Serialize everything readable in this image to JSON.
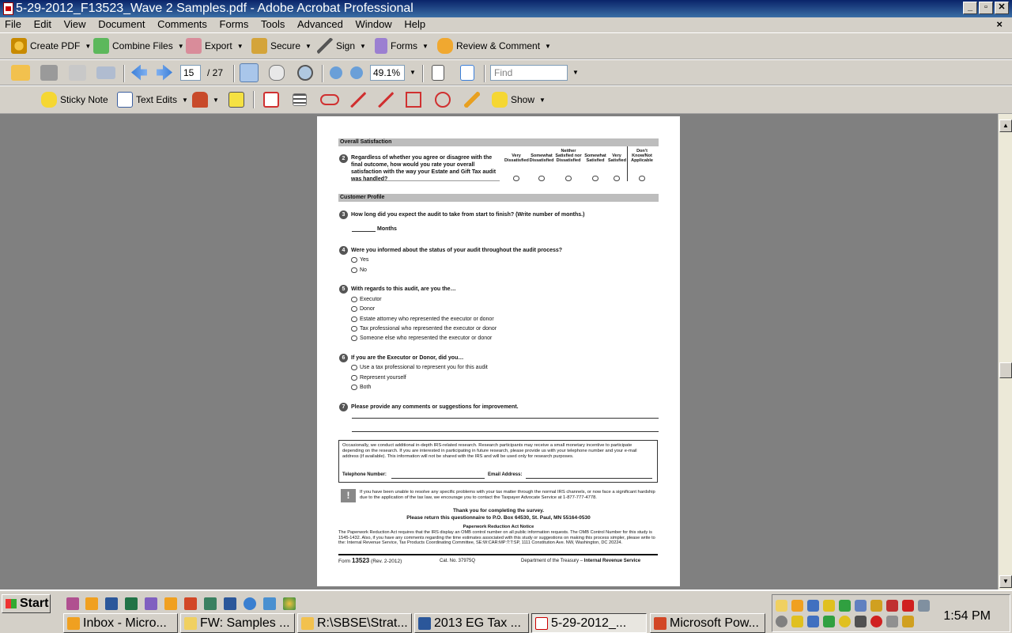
{
  "window": {
    "title": "5-29-2012_F13523_Wave 2 Samples.pdf - Adobe Acrobat Professional",
    "minimize": "_",
    "restore": "▫",
    "close": "✕"
  },
  "menu": [
    "File",
    "Edit",
    "View",
    "Document",
    "Comments",
    "Forms",
    "Tools",
    "Advanced",
    "Window",
    "Help"
  ],
  "menu_close": "×",
  "toolbar1": {
    "create_pdf": "Create PDF",
    "combine_files": "Combine Files",
    "export": "Export",
    "secure": "Secure",
    "sign": "Sign",
    "forms": "Forms",
    "review_comment": "Review & Comment"
  },
  "toolbar2": {
    "page_current": "15",
    "page_total": "/ 27",
    "zoom": "49.1%",
    "find_placeholder": "Find"
  },
  "toolbar3": {
    "sticky_note": "Sticky Note",
    "text_edits": "Text Edits",
    "show": "Show"
  },
  "document": {
    "section_overall": "Overall Satisfaction",
    "q2_num": "2",
    "q2_text": "Regardless of whether you agree or disagree with the final outcome, how would you rate your overall satisfaction with the way your Estate and Gift Tax audit was handled?",
    "scale": [
      "Very Dissatisfied",
      "Somewhat Dissatisfied",
      "Neither Satisfied nor Dissatisfied",
      "Somewhat Satisfied",
      "Very Satisfied",
      "Don't Know/Not Applicable"
    ],
    "section_profile": "Customer Profile",
    "q3_num": "3",
    "q3_text": "How long did you expect the audit to take from start to finish? (Write number of months.)",
    "q3_months": "Months",
    "q4_num": "4",
    "q4_text": "Were you informed about the status of your audit throughout the audit process?",
    "q4_options": [
      "Yes",
      "No"
    ],
    "q5_num": "5",
    "q5_text": "With regards to this audit, are you the…",
    "q5_options": [
      "Executor",
      "Donor",
      "Estate attorney who represented the executor or donor",
      "Tax professional who represented the executor or donor",
      "Someone else who represented the executor or donor"
    ],
    "q6_num": "6",
    "q6_text": "If you are the Executor or Donor, did you…",
    "q6_options": [
      "Use a tax professional to represent you for this audit",
      "Represent yourself",
      "Both"
    ],
    "q7_num": "7",
    "q7_text": "Please provide any comments or suggestions for improvement.",
    "research_text": "Occasionally, we conduct additional in-depth IRS-related research. Research participants may receive a small monetary incentive to participate depending on the research. If you are interested in participating in future research, please provide us with your telephone number and your e-mail address (if available). This information will not be shared with the IRS and will be used only for research purposes.",
    "telephone_label": "Telephone Number:",
    "email_label": "Email Address:",
    "advocate_text": "If you have been unable to resolve any specific problems with your tax matter through the normal IRS channels, or now face a significant hardship due to the application of the tax law, we encourage you to contact the Taxpayer Advocate Service at 1-877-777-4778.",
    "thanks": "Thank you for completing the survey.",
    "return_address": "Please return this questionnaire to P.O. Box 64530, St. Paul, MN 55164-0530",
    "pra_title": "Paperwork Reduction Act Notice",
    "pra_text": "The Paperwork Reduction Act requires that the IRS display an OMB control number on all public information requests. The OMB Control Number for this study is 1545-1432. Also, if you have any comments regarding the time estimates associated with this study or suggestions on making this process simpler, please write to the: Internal Revenue Service, Tax Products Coordinating Committee, SE:W:CAR:MP:T:T:SP, 1111 Constitution Ave. NW, Washington, DC 20224.",
    "form_label": "Form",
    "form_number": "13523",
    "form_rev": "(Rev. 2-2012)",
    "cat_no": "Cat. No. 37975Q",
    "dept": "Department of the Treasury –",
    "irs": "Internal Revenue Service"
  },
  "taskbar": {
    "start": "Start",
    "buttons": [
      "Inbox - Micro...",
      "FW: Samples ...",
      "R:\\SBSE\\Strat...",
      "2013 EG Tax ...",
      "5-29-2012_...",
      "Microsoft Pow..."
    ],
    "clock": "1:54 PM"
  },
  "colors": {
    "titlebar": "#0a246a",
    "face": "#d4d0c8",
    "doc_bg": "#808080"
  }
}
